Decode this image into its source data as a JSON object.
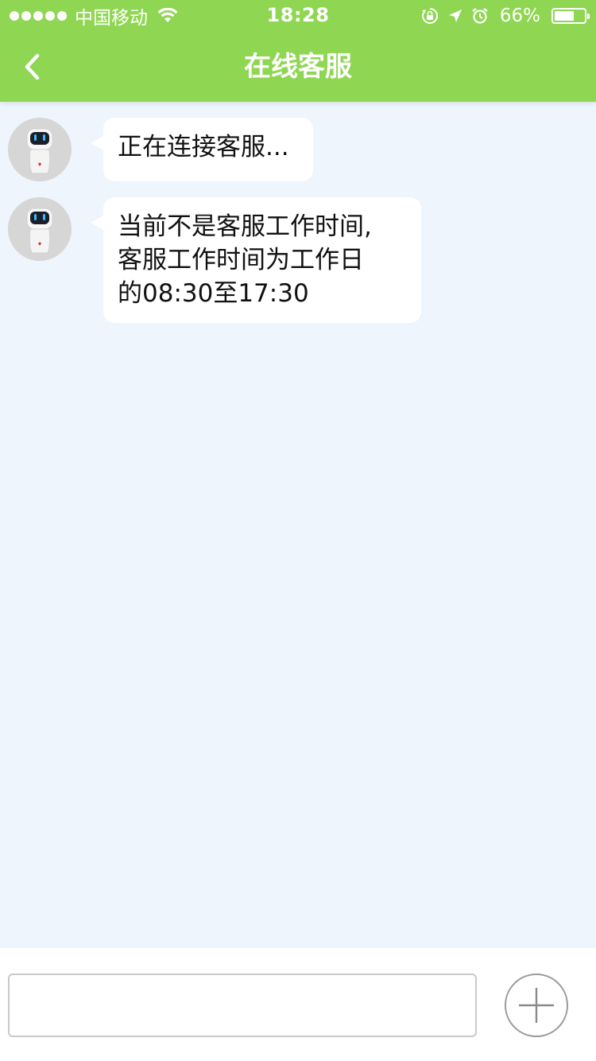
{
  "status_bar": {
    "carrier": "中国移动",
    "time": "18:28",
    "battery_percent": "66%",
    "battery_level": 0.66,
    "icons": [
      "signal-dots",
      "wifi-icon",
      "orientation-lock-icon",
      "location-arrow-icon",
      "alarm-icon",
      "battery-icon"
    ]
  },
  "nav": {
    "title": "在线客服",
    "back_icon": "chevron-left-icon"
  },
  "messages": [
    {
      "sender": "bot",
      "avatar_icon": "robot-avatar-icon",
      "text": "正在连接客服..."
    },
    {
      "sender": "bot",
      "avatar_icon": "robot-avatar-icon",
      "text": "当前不是客服工作时间,\n客服工作时间为工作日\n的08:30至17:30"
    }
  ],
  "input": {
    "value": "",
    "placeholder": ""
  },
  "colors": {
    "header": "#8fd652",
    "chat_background": "#eef5fd",
    "bubble": "#ffffff"
  }
}
